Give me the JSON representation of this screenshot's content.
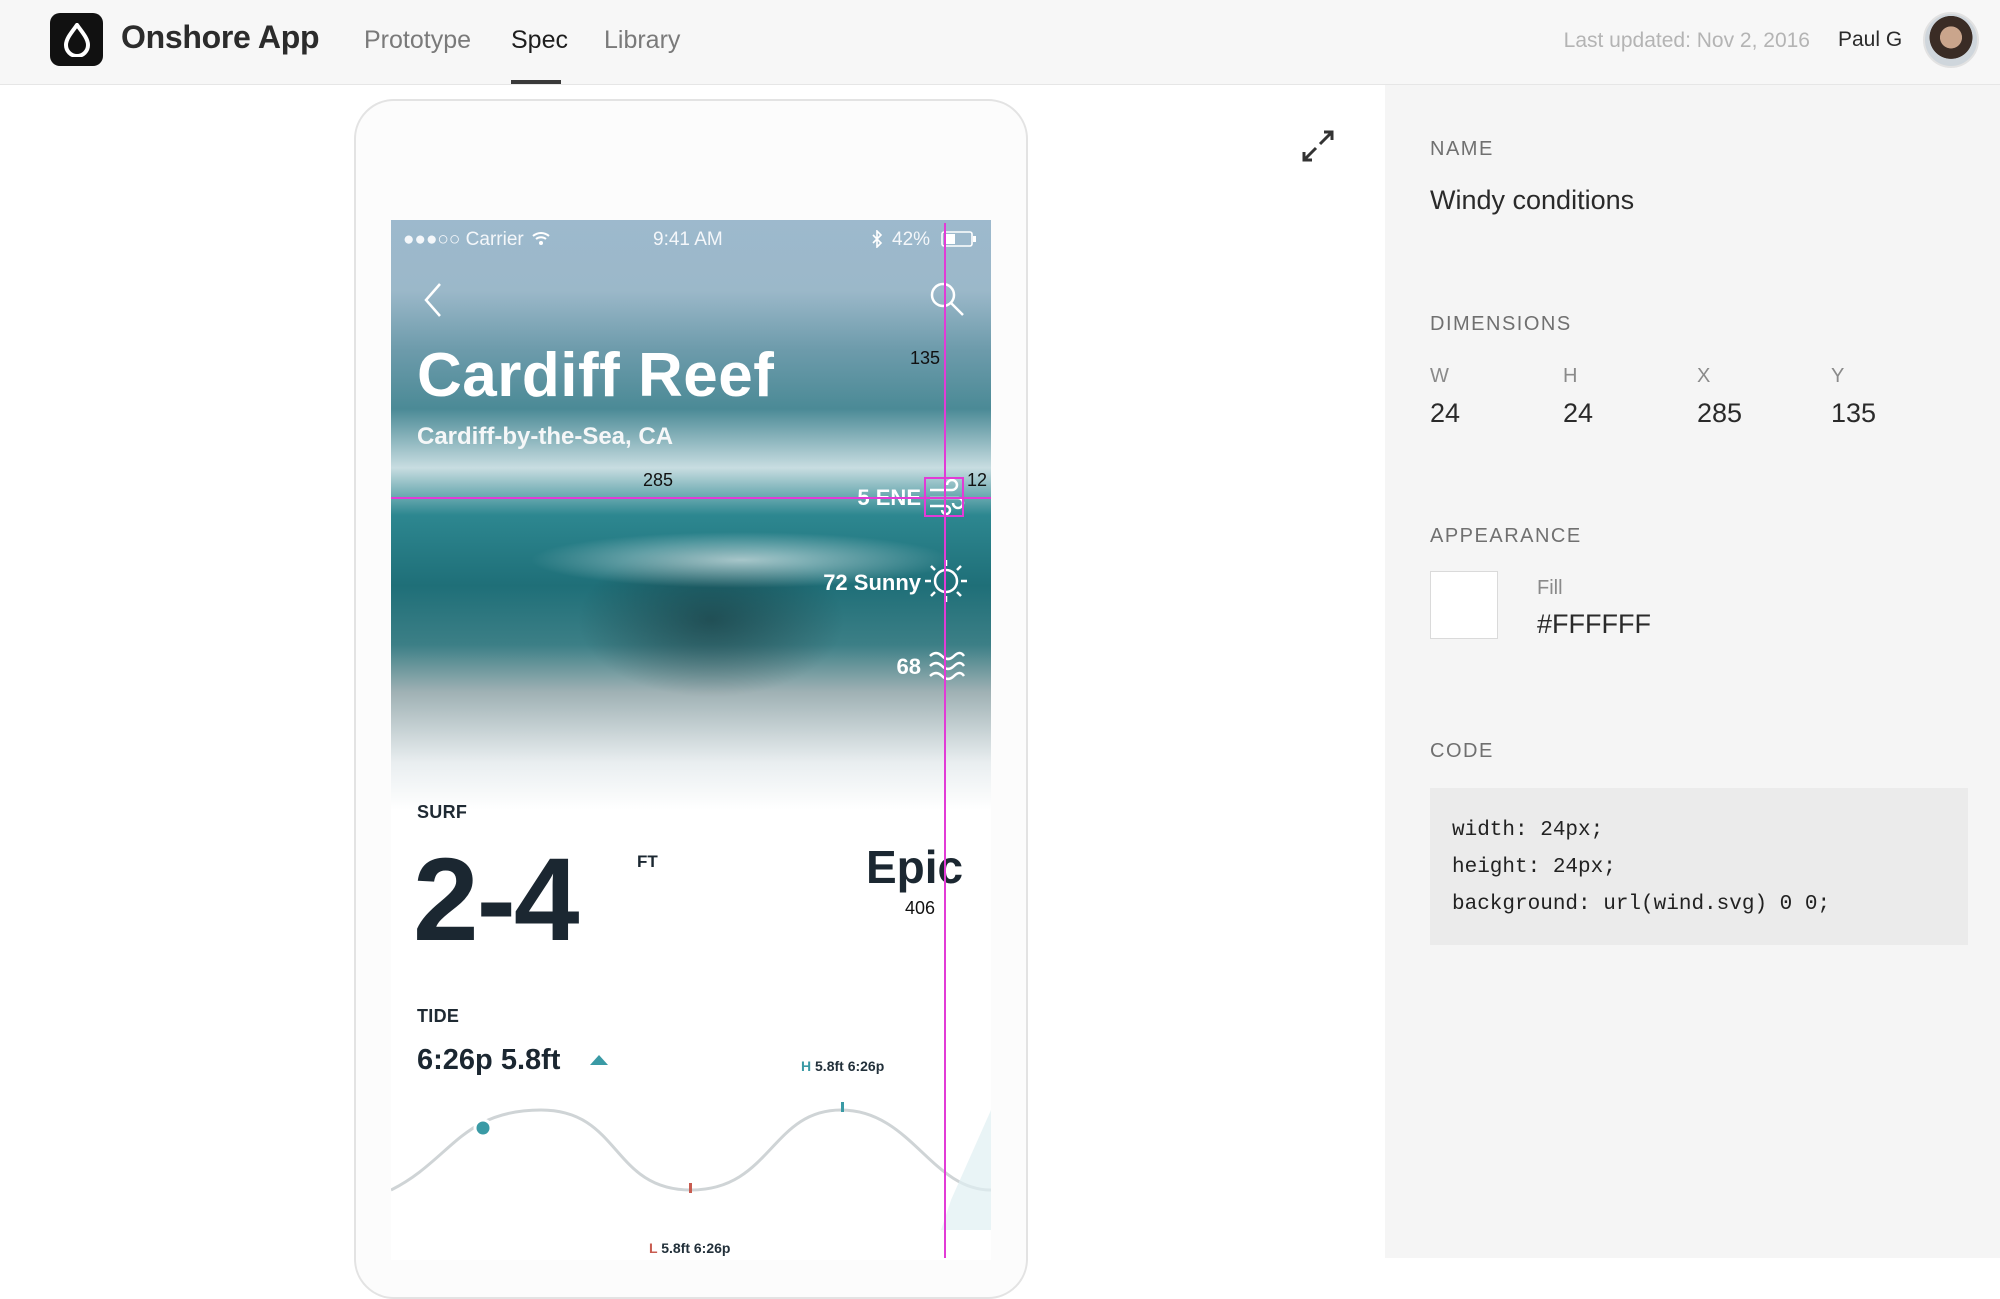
{
  "header": {
    "app_title": "Onshore App",
    "tabs": [
      {
        "label": "Prototype",
        "active": false
      },
      {
        "label": "Spec",
        "active": true
      },
      {
        "label": "Library",
        "active": false
      }
    ],
    "last_updated": "Last updated: Nov 2, 2016",
    "user_name": "Paul G"
  },
  "device": {
    "status_bar": {
      "carrier": "●●●○○ Carrier",
      "time": "9:41 AM",
      "battery": "42%"
    },
    "title": "Cardiff Reef",
    "subtitle": "Cardiff-by-the-Sea, CA",
    "conditions": [
      {
        "text": "5 ENE",
        "icon": "wind-icon"
      },
      {
        "text": "72 Sunny",
        "icon": "sun-icon"
      },
      {
        "text": "68",
        "icon": "water-temp-icon"
      }
    ],
    "surf": {
      "label": "SURF",
      "value": "2-4",
      "unit": "FT",
      "rating": "Epic"
    },
    "tide": {
      "label": "TIDE",
      "value": "6:26p 5.8ft",
      "high_letter": "H",
      "high_text": "5.8ft 6:26p",
      "low_letter": "L",
      "low_text": "5.8ft 6:26p"
    },
    "measurements": {
      "top": "135",
      "left": "285",
      "right": "12",
      "bottom": "406"
    }
  },
  "panel": {
    "name_label": "NAME",
    "name_value": "Windy conditions",
    "dimensions_label": "DIMENSIONS",
    "dimensions": [
      {
        "label": "W",
        "value": "24"
      },
      {
        "label": "H",
        "value": "24"
      },
      {
        "label": "X",
        "value": "285"
      },
      {
        "label": "Y",
        "value": "135"
      }
    ],
    "appearance_label": "APPEARANCE",
    "fill_label": "Fill",
    "fill_value": "#FFFFFF",
    "code_label": "CODE",
    "code_lines": [
      "width: 24px;",
      "height: 24px;",
      "background: url(wind.svg) 0 0;"
    ]
  },
  "colors": {
    "accent_guide": "#E23BD6",
    "tide_accent": "#3A9AA5"
  }
}
